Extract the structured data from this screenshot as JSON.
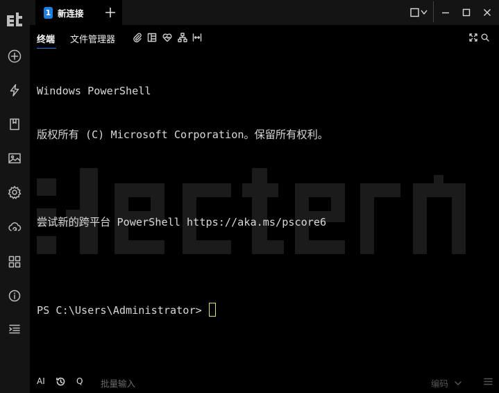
{
  "sidebar": {
    "logo_icon": "electerm-logo-icon",
    "items": [
      {
        "icon": "add-circle-icon"
      },
      {
        "icon": "lightning-icon"
      },
      {
        "icon": "bookmark-icon"
      },
      {
        "icon": "image-icon"
      },
      {
        "icon": "gear-icon"
      },
      {
        "icon": "cloud-sync-icon"
      },
      {
        "icon": "grid-icon"
      },
      {
        "icon": "info-icon"
      },
      {
        "icon": "menu-list-icon"
      }
    ]
  },
  "tabs": [
    {
      "number": "1",
      "label": "新连接"
    }
  ],
  "toolbar": {
    "terminal_tab": "终端",
    "file_manager_tab": "文件管理器"
  },
  "terminal": {
    "lines": [
      "Windows PowerShell",
      "版权所有 (C) Microsoft Corporation。保留所有权利。",
      "",
      "尝试新的跨平台 PowerShell https://aka.ms/pscore6",
      "",
      "PS C:\\Users\\Administrator> "
    ]
  },
  "bottombar": {
    "ai_label": "AI",
    "q_label": "Q",
    "batch_input_placeholder": "批量输入",
    "encoding_label": "编码"
  },
  "colors": {
    "accent": "#1e7de0",
    "cursor": "#e6e26a",
    "online": "#3ddc84"
  }
}
